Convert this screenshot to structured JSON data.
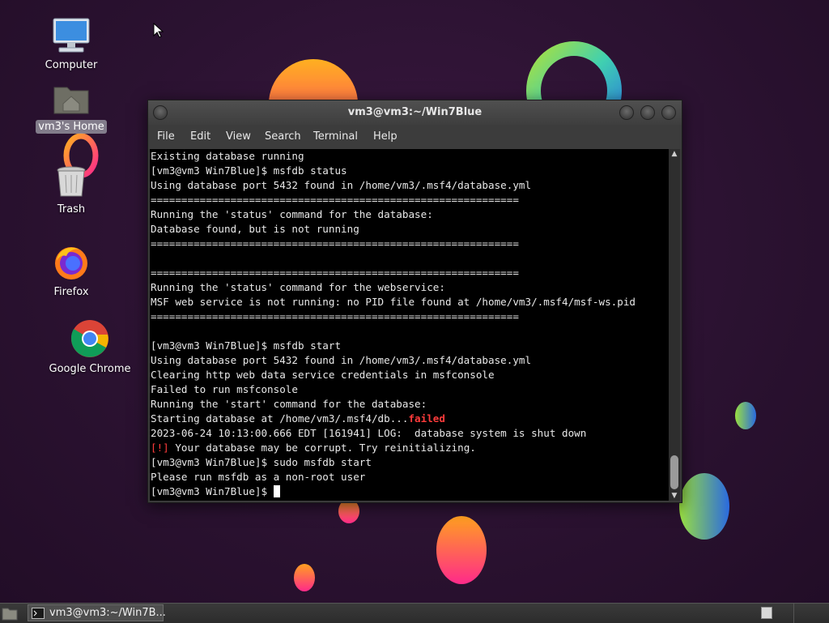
{
  "desktop": {
    "icons": [
      {
        "label": "Computer"
      },
      {
        "label": "vm3's Home"
      },
      {
        "label": "Trash"
      },
      {
        "label": "Firefox"
      },
      {
        "label": "Google Chrome"
      }
    ]
  },
  "terminal": {
    "title": "vm3@vm3:~/Win7Blue",
    "menu": [
      "File",
      "Edit",
      "View",
      "Search",
      "Terminal",
      "Help"
    ],
    "lines": [
      "Existing database running",
      "[vm3@vm3 Win7Blue]$ msfdb status",
      "Using database port 5432 found in /home/vm3/.msf4/database.yml",
      "============================================================",
      "Running the 'status' command for the database:",
      "Database found, but is not running",
      "============================================================",
      "",
      "============================================================",
      "Running the 'status' command for the webservice:",
      "MSF web service is not running: no PID file found at /home/vm3/.msf4/msf-ws.pid",
      "============================================================",
      "",
      "[vm3@vm3 Win7Blue]$ msfdb start",
      "Using database port 5432 found in /home/vm3/.msf4/database.yml",
      "Clearing http web data service credentials in msfconsole",
      "Failed to run msfconsole",
      "Running the 'start' command for the database:",
      "Starting database at /home/vm3/.msf4/db...",
      "2023-06-24 10:13:00.666 EDT [161941] LOG:  database system is shut down",
      "Your database may be corrupt. Try reinitializing.",
      "[vm3@vm3 Win7Blue]$ sudo msfdb start",
      "Please run msfdb as a non-root user",
      "[vm3@vm3 Win7Blue]$ "
    ],
    "failed_word": "failed",
    "warning_marker": "[!]",
    "colors": {
      "error": "#ff3b3b",
      "background": "#000000",
      "text": "#e8e8e8"
    }
  },
  "taskbar": {
    "task_label": "vm3@vm3:~/Win7B..."
  }
}
